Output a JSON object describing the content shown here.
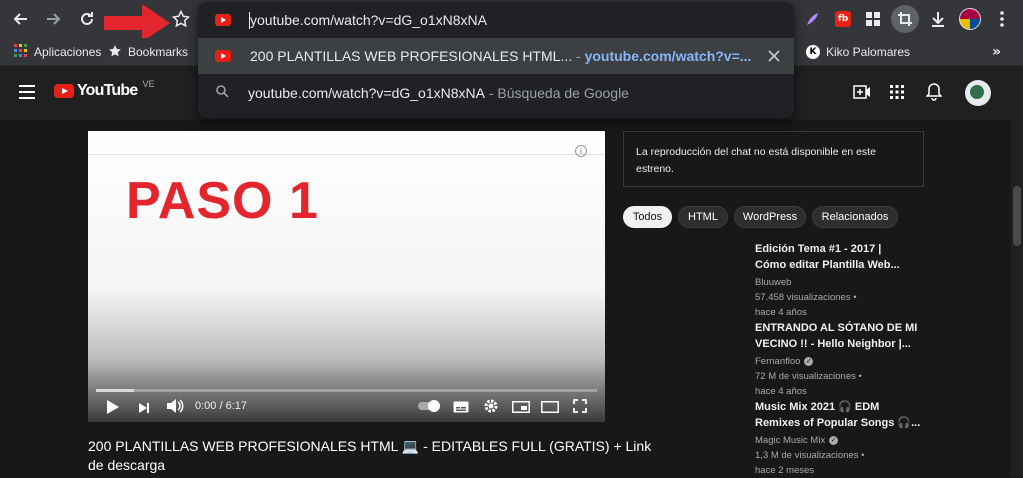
{
  "omnibox": {
    "typed_url": "youtube.com/watch?v=dG_o1xN8xNA",
    "suggestions": [
      {
        "title": "200 PLANTILLAS WEB PROFESIONALES HTML...",
        "separator": " - ",
        "url": "youtube.com/watch?v=..."
      },
      {
        "query": "youtube.com/watch?v=dG_o1xN8xNA",
        "separator": " - ",
        "engine": "Búsqueda de Google"
      }
    ]
  },
  "bookmarks": {
    "apps": "Aplicaciones",
    "bookmarks": "Bookmarks",
    "profile": "Kiko Palomares"
  },
  "youtube": {
    "logo": "YouTube",
    "country": "VE"
  },
  "player": {
    "overlay_text": "PASO 1",
    "time": "0:00 / 6:17",
    "progress": 0
  },
  "video": {
    "title_line1": "200 PLANTILLAS WEB PROFESIONALES HTML 💻 - EDITABLES FULL (GRATIS) + Link",
    "title_line2": "de descarga"
  },
  "chat": {
    "message": "La reproducción del chat no está disponible en este estreno."
  },
  "chips": [
    "Todos",
    "HTML",
    "WordPress",
    "Relacionados"
  ],
  "recommended": [
    {
      "title_line1": "Edición Tema #1 - 2017 |",
      "title_line2": "Cómo editar Plantilla Web...",
      "channel": "Bluuweb",
      "views": "57.458 visualizaciones",
      "age": "hace 4 años",
      "verified": false
    },
    {
      "title_line1": "ENTRANDO AL SÓTANO DE MI",
      "title_line2": "VECINO !! - Hello Neighbor |...",
      "channel": "Fernanfloo",
      "views": "72 M de visualizaciones",
      "age": "hace 4 años",
      "verified": true
    },
    {
      "title_line1": "Music Mix 2021 🎧 EDM",
      "title_line2": "Remixes of Popular Songs 🎧...",
      "channel": "Magic Music Mix",
      "views": "1,3 M de visualizaciones",
      "age": "hace 2 meses",
      "verified": true
    }
  ],
  "colors": {
    "accent_red": "#e62117",
    "annotation_arrow": "#e3262e",
    "link_blue": "#8ab4f8"
  }
}
